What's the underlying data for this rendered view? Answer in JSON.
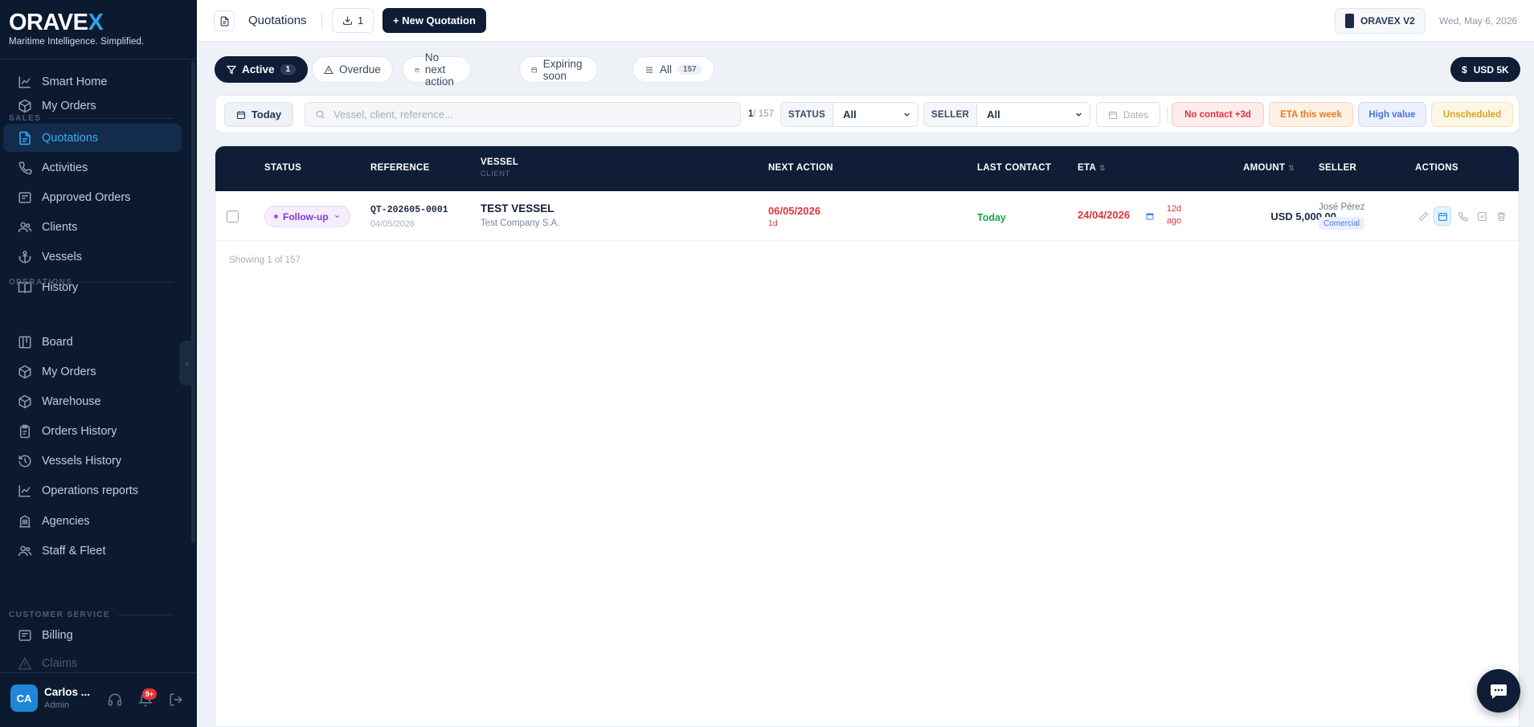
{
  "brand": {
    "name_main": "ORAVE",
    "name_accent": "X",
    "tagline": "Maritime Intelligence. Simplified."
  },
  "sidebar": {
    "items": [
      {
        "label": "Smart Home",
        "icon": "chart-line-icon"
      },
      {
        "label": "My Orders",
        "icon": "box-icon"
      },
      {
        "section": "SALES"
      },
      {
        "label": "Quotations",
        "icon": "document-icon",
        "active": true
      },
      {
        "label": "Activities",
        "icon": "phone-icon"
      },
      {
        "label": "Approved Orders",
        "icon": "receipt-icon"
      },
      {
        "label": "Clients",
        "icon": "users-icon"
      },
      {
        "label": "Vessels",
        "icon": "anchor-icon"
      },
      {
        "label": "History",
        "icon": "book-icon"
      },
      {
        "section": "OPERATIONS"
      },
      {
        "label": "Board",
        "icon": "board-icon"
      },
      {
        "label": "My Orders",
        "icon": "box-icon"
      },
      {
        "label": "Warehouse",
        "icon": "box-icon"
      },
      {
        "label": "Orders History",
        "icon": "clipboard-icon"
      },
      {
        "label": "Vessels History",
        "icon": "history-icon"
      },
      {
        "label": "Operations reports",
        "icon": "chart-line-icon"
      },
      {
        "label": "Agencies",
        "icon": "building-icon"
      },
      {
        "label": "Staff & Fleet",
        "icon": "users-icon"
      },
      {
        "section": "CUSTOMER SERVICE"
      },
      {
        "label": "Billing",
        "icon": "receipt-icon"
      },
      {
        "label": "Claims",
        "icon": "warning-icon",
        "faded": true
      }
    ]
  },
  "user": {
    "initials": "CA",
    "name": "Carlos ...",
    "role": "Admin",
    "notifications": "9+"
  },
  "topbar": {
    "title": "Quotations",
    "export_count": "1",
    "new_button": "+ New Quotation",
    "app_label": "ORAVEX V2",
    "date": "Wed, May 6, 2026"
  },
  "tabs": [
    {
      "label": "Active",
      "count": "1",
      "active": true,
      "icon": "funnel-icon"
    },
    {
      "label": "Overdue",
      "count": "",
      "icon": "warning-icon"
    },
    {
      "label": "No next action",
      "count": "",
      "icon": "calendar-icon"
    },
    {
      "label": "Expiring soon",
      "count": "",
      "icon": "hourglass-icon"
    },
    {
      "label": "All",
      "count": "157",
      "icon": "list-icon"
    }
  ],
  "usd_chip": {
    "currency_symbol": "$",
    "label": "USD 5K"
  },
  "filters": {
    "today": "Today",
    "search_placeholder": "Vessel, client, reference...",
    "counter_current": "1",
    "counter_total": "/ 157",
    "status_label": "STATUS",
    "status_value": "All",
    "seller_label": "SELLER",
    "seller_value": "All",
    "dates": "Dates",
    "quick": [
      {
        "label": "No contact +3d",
        "color": "#e0343c",
        "bg": "#fdecec",
        "border": "#f7c9cb"
      },
      {
        "label": "ETA this week",
        "color": "#ea7a1c",
        "bg": "#fdf1e6",
        "border": "#f8d6b6"
      },
      {
        "label": "High value",
        "color": "#4a6fe0",
        "bg": "#edf1fd",
        "border": "#cbd6f8"
      },
      {
        "label": "Unscheduled",
        "color": "#d9a21b",
        "bg": "#fdf7e6",
        "border": "#f5e2ae"
      }
    ]
  },
  "table": {
    "headers": {
      "status": "STATUS",
      "reference": "REFERENCE",
      "vessel": "VESSEL",
      "vessel_sub": "CLIENT",
      "next_action": "NEXT ACTION",
      "last_contact": "LAST CONTACT",
      "eta": "ETA",
      "amount": "AMOUNT",
      "seller": "SELLER",
      "actions": "ACTIONS"
    },
    "rows": [
      {
        "status": "Follow-up",
        "reference": "QT-202605-0001",
        "reference_date": "04/05/2026",
        "vessel": "TEST VESSEL",
        "client": "Test Company S.A.",
        "next_action_date": "06/05/2026",
        "next_action_sub": "1d",
        "last_contact": "Today",
        "eta": "24/04/2026",
        "eta_ago": "12d ago",
        "amount": "USD 5,000.00",
        "seller": "José Pérez",
        "seller_role": "Comercial"
      }
    ],
    "showing": "Showing 1 of 157"
  },
  "colors": {
    "sidebar_bg": "#0c1a30",
    "accent": "#2aa7e8",
    "header_bg": "#0f1d36",
    "danger": "#e0343c",
    "success": "#1aa552"
  }
}
